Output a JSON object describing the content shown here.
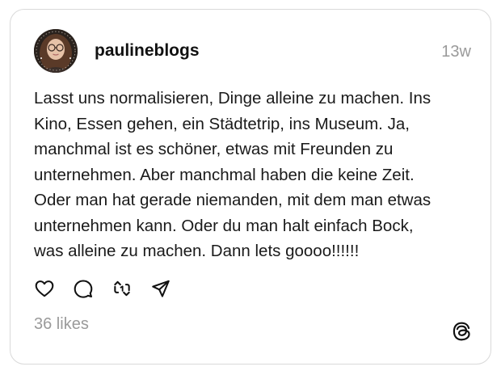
{
  "post": {
    "username": "paulineblogs",
    "timestamp": "13w",
    "text": "Lasst uns normalisieren, Dinge alleine zu machen. Ins\nKino, Essen gehen, ein Städtetrip, ins Museum. Ja,\nmanchmal ist es schöner, etwas mit Freunden zu\nunternehmen. Aber manchmal haben die keine Zeit.\nOder man hat gerade niemanden, mit dem man etwas\nunternehmen kann. Oder du man halt einfach Bock,\nwas alleine zu machen. Dann lets goooo!!!!!!",
    "likes": "36 likes"
  },
  "actions": [
    {
      "icon": "heart-icon"
    },
    {
      "icon": "comment-icon"
    },
    {
      "icon": "repost-icon"
    },
    {
      "icon": "share-icon"
    }
  ],
  "colors": {
    "text": "#1a1a1a",
    "muted": "#9a9a9a",
    "border": "#d9d9d9"
  },
  "brand_icon": "threads-logo-icon"
}
